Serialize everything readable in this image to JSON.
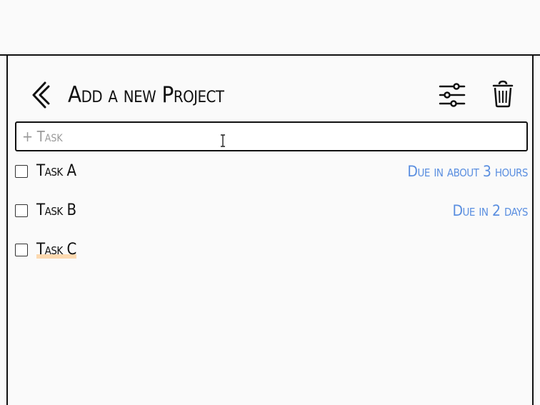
{
  "header": {
    "title": "Add a new Project",
    "back_icon": "chevron-left-icon",
    "filter_icon": "sliders-icon",
    "delete_icon": "trash-icon"
  },
  "task_input": {
    "placeholder": "+ Task",
    "value": ""
  },
  "tasks": [
    {
      "label": "Task A",
      "due": "Due in about 3 hours",
      "checked": false
    },
    {
      "label": "Task B",
      "due": "Due in 2 days",
      "checked": false
    },
    {
      "label": "Task C",
      "due": "",
      "checked": false
    }
  ],
  "colors": {
    "accent": "#5b8fe0",
    "highlight": "#fcd9b0",
    "border": "#111111"
  }
}
